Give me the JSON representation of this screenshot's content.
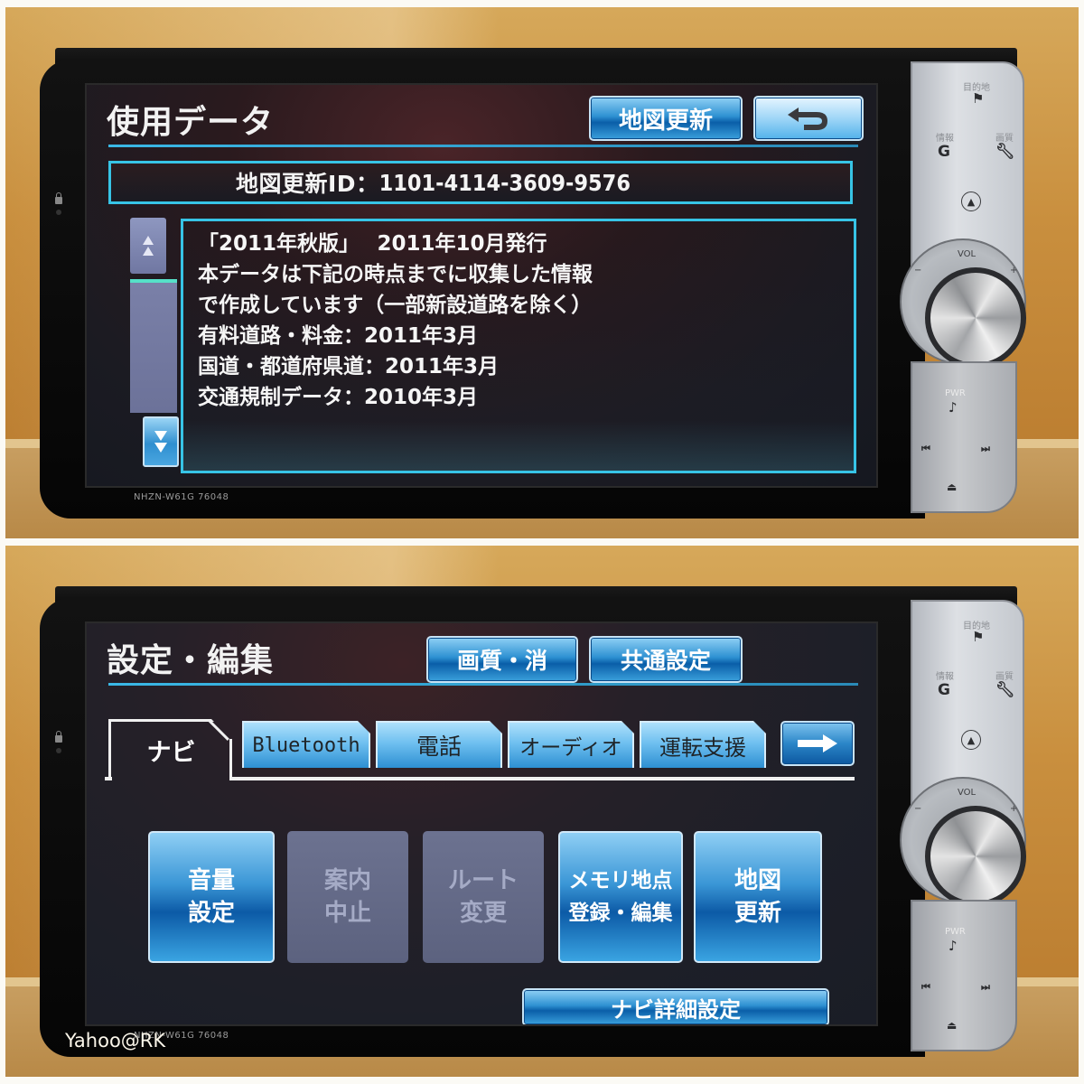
{
  "top_photo": {
    "model_label": "NHZN-W61G   76048",
    "screen": {
      "title": "使用データ",
      "map_update_button": "地図更新",
      "back_button_icon": "return-arrow-icon",
      "map_update_id_label": "地図更新ID：",
      "map_update_id_value": "1101-4114-3609-9576",
      "scroll_up_icon": "double-chevron-up-icon",
      "scroll_down_icon": "double-chevron-down-icon",
      "info_lines": [
        "「2011年秋版」　 2011年10月発行",
        "本データは下記の時点までに収集した情報",
        "で作成しています（一部新設道路を除く）",
        "有料道路・料金：2011年3月",
        "国道・都道府県道：2011年3月",
        "交通規制データ：2010年3月"
      ]
    },
    "panel": {
      "destination_label": "目的地",
      "info_label": "情報",
      "image_label": "画質",
      "vol_label": "VOL",
      "vol_minus": "−",
      "vol_plus": "+",
      "pwr_label": "PWR"
    }
  },
  "bottom_photo": {
    "model_label": "NHZN-W61G   76048",
    "screen": {
      "title": "設定・編集",
      "header_buttons": [
        "画質・消",
        "共通設定"
      ],
      "tabs": [
        {
          "label": "ナビ",
          "active": true
        },
        {
          "label": "Bluetooth",
          "active": false
        },
        {
          "label": "電話",
          "active": false
        },
        {
          "label": "オーディオ",
          "active": false
        },
        {
          "label": "運転支援",
          "active": false
        }
      ],
      "next_tab_icon": "right-arrow-icon",
      "tiles": [
        {
          "line1": "音量",
          "line2": "設定",
          "enabled": true
        },
        {
          "line1": "案内",
          "line2": "中止",
          "enabled": false
        },
        {
          "line1": "ルート",
          "line2": "変更",
          "enabled": false
        },
        {
          "line1": "メモリ地点",
          "line2": "登録・編集",
          "enabled": true
        },
        {
          "line1": "地図",
          "line2": "更新",
          "enabled": true
        }
      ],
      "detail_button": "ナビ詳細設定"
    },
    "panel": {
      "destination_label": "目的地",
      "info_label": "情報",
      "image_label": "画質",
      "vol_label": "VOL",
      "vol_minus": "−",
      "vol_plus": "+",
      "pwr_label": "PWR"
    }
  },
  "watermark": "Yahoo@RK",
  "colors": {
    "accent_cyan": "#37c4e6",
    "button_blue": "#2e91d2",
    "disabled_tile": "#626884",
    "screen_bg": "#1b1b22"
  }
}
